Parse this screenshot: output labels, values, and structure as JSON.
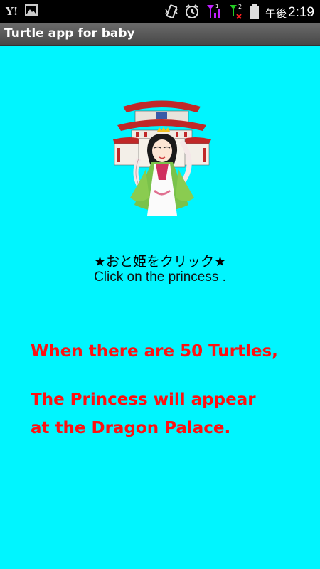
{
  "status_bar": {
    "carrier_logo": "Y!",
    "time_prefix": "午後",
    "time": "2:19",
    "icons": [
      "yahoo-icon",
      "image-icon",
      "vibrate-icon",
      "alarm-icon",
      "signal-icon",
      "signal-2-icon",
      "battery-icon"
    ]
  },
  "app_title": "Turtle app for baby",
  "princess_image": "princess-dragon-palace-image",
  "caption": {
    "japanese": "★おと姫をクリック★",
    "english": "Click on the princess ."
  },
  "message": {
    "line1": "When there are 50 Turtles,",
    "line2": "The Princess will appear",
    "line3": "at the Dragon Palace."
  },
  "colors": {
    "background": "#00f5ff",
    "message_text": "#ff1010",
    "title_bar": "#555555"
  }
}
